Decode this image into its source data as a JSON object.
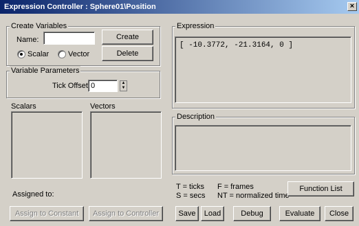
{
  "window": {
    "title": "Expression Controller : Sphere01\\Position",
    "close_glyph": "×"
  },
  "create_variables": {
    "group_label": "Create Variables",
    "name_label": "Name:",
    "name_value": "",
    "create_label": "Create",
    "delete_label": "Delete",
    "scalar_label": "Scalar",
    "vector_label": "Vector",
    "selected_type": "Scalar"
  },
  "variable_parameters": {
    "group_label": "Variable Parameters",
    "tick_offset_label": "Tick Offset:",
    "tick_offset_value": "0"
  },
  "lists": {
    "scalars_label": "Scalars",
    "vectors_label": "Vectors"
  },
  "assigned_to_label": "Assigned to:",
  "assign_constant_label": "Assign to Constant",
  "assign_controller_label": "Assign to Controller",
  "expression": {
    "group_label": "Expression",
    "text": "[ -10.3772, -21.3164, 0 ]"
  },
  "description": {
    "group_label": "Description",
    "text": ""
  },
  "legend": {
    "ticks": "T = ticks",
    "frames": "F = frames",
    "secs": "S = secs",
    "normalized": "NT = normalized time"
  },
  "buttons": {
    "function_list": "Function List",
    "save": "Save",
    "load": "Load",
    "debug": "Debug",
    "evaluate": "Evaluate",
    "close": "Close"
  }
}
